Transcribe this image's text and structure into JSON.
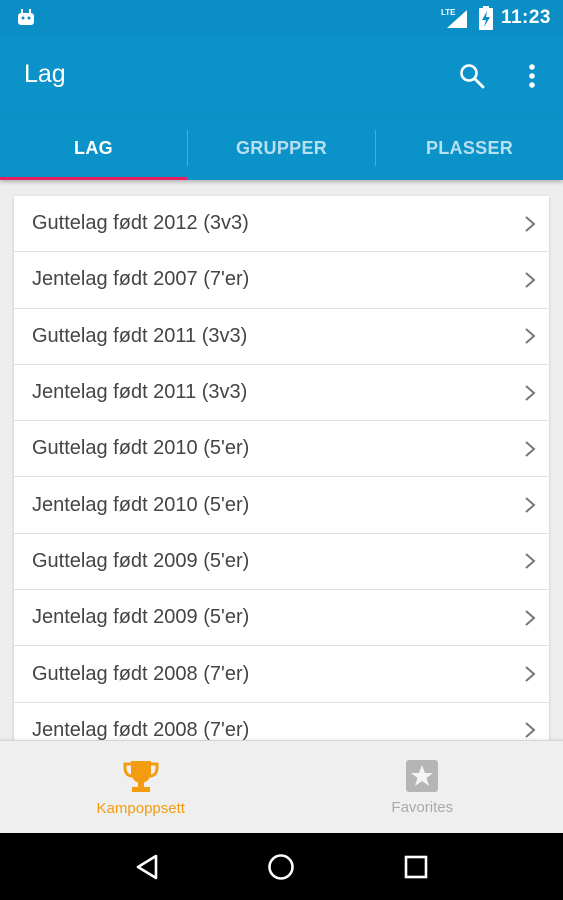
{
  "status_bar": {
    "network": "LTE",
    "time": "11:23"
  },
  "app_bar": {
    "title": "Lag",
    "search_icon": "search-icon",
    "menu_icon": "more-vert-icon"
  },
  "tabs": [
    {
      "label": "LAG",
      "active": true
    },
    {
      "label": "GRUPPER",
      "active": false
    },
    {
      "label": "PLASSER",
      "active": false
    }
  ],
  "teams": [
    "Guttelag født 2012 (3v3)",
    "Jentelag født 2007 (7'er)",
    "Guttelag født 2011 (3v3)",
    "Jentelag født 2011 (3v3)",
    "Guttelag født 2010 (5'er)",
    "Jentelag født 2010 (5'er)",
    "Guttelag født 2009 (5'er)",
    "Jentelag født 2009 (5'er)",
    "Guttelag født 2008 (7'er)",
    "Jentelag født 2008 (7'er)"
  ],
  "bottom_nav": [
    {
      "label": "Kampoppsett",
      "icon": "trophy-icon",
      "active": true
    },
    {
      "label": "Favorites",
      "icon": "star-icon",
      "active": false
    }
  ],
  "colors": {
    "primary": "#0b93c9",
    "accent": "#e91e63",
    "active_nav": "#f39c12"
  }
}
